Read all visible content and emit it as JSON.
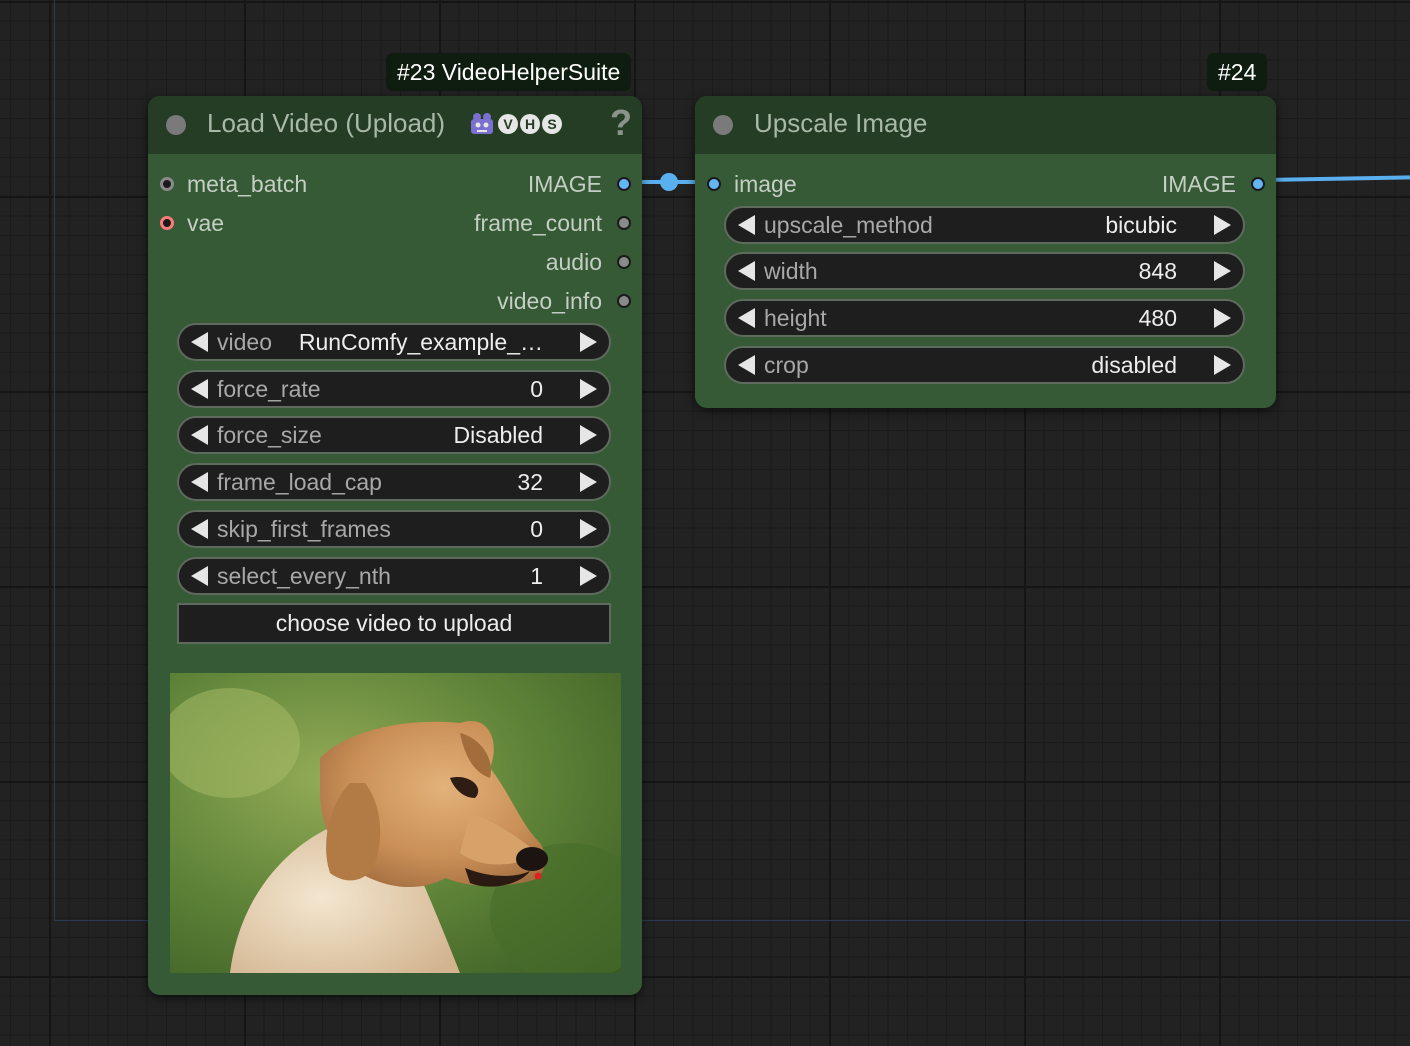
{
  "canvas": {
    "background": "#222222",
    "link_color": "#5ab0ee"
  },
  "node23": {
    "badge": "#23 VideoHelperSuite",
    "title": "Load Video (Upload)",
    "icon": "robot-icon",
    "vhs_letters": [
      "V",
      "H",
      "S"
    ],
    "help": "?",
    "inputs": [
      {
        "label": "meta_batch",
        "color": "#8a8a8a"
      },
      {
        "label": "vae",
        "color": "#ff7a7a"
      }
    ],
    "outputs": [
      {
        "label": "IMAGE",
        "color": "#64b5f6"
      },
      {
        "label": "frame_count",
        "color": "#8a8a8a"
      },
      {
        "label": "audio",
        "color": "#8a8a8a"
      },
      {
        "label": "video_info",
        "color": "#8a8a8a"
      }
    ],
    "widgets": [
      {
        "label": "video",
        "value": "RunComfy_example_…"
      },
      {
        "label": "force_rate",
        "value": "0"
      },
      {
        "label": "force_size",
        "value": "Disabled"
      },
      {
        "label": "frame_load_cap",
        "value": "32"
      },
      {
        "label": "skip_first_frames",
        "value": "0"
      },
      {
        "label": "select_every_nth",
        "value": "1"
      }
    ],
    "upload_button": "choose video to upload",
    "preview": "golden-retriever-dog-image"
  },
  "node24": {
    "badge": "#24",
    "title": "Upscale Image",
    "input": {
      "label": "image",
      "color": "#64b5f6"
    },
    "output": {
      "label": "IMAGE",
      "color": "#64b5f6"
    },
    "widgets": [
      {
        "label": "upscale_method",
        "value": "bicubic"
      },
      {
        "label": "width",
        "value": "848"
      },
      {
        "label": "height",
        "value": "480"
      },
      {
        "label": "crop",
        "value": "disabled"
      }
    ]
  }
}
